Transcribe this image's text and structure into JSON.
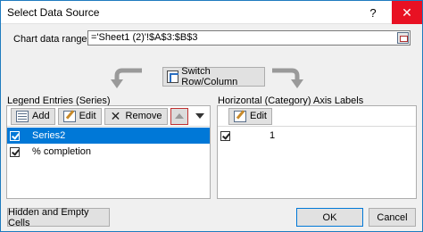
{
  "window": {
    "title": "Select Data Source",
    "help_glyph": "?",
    "close_glyph": "✕"
  },
  "range": {
    "label": "Chart data range:",
    "value": "='Sheet1 (2)'!$A$3:$B$3"
  },
  "switch_button": "Switch Row/Column",
  "series_panel": {
    "label": "Legend Entries (Series)",
    "add": "Add",
    "edit": "Edit",
    "remove": "Remove",
    "rows": [
      {
        "label": "Series2",
        "checked": true,
        "selected": true
      },
      {
        "label": "% completion",
        "checked": true,
        "selected": false
      }
    ]
  },
  "axis_panel": {
    "label": "Horizontal (Category) Axis Labels",
    "edit": "Edit",
    "rows": [
      {
        "label": "1",
        "checked": true
      }
    ]
  },
  "footer": {
    "hidden_empty": "Hidden and Empty Cells",
    "ok": "OK",
    "cancel": "Cancel"
  },
  "colors": {
    "selection": "#0078d7",
    "close_button": "#e81123"
  }
}
